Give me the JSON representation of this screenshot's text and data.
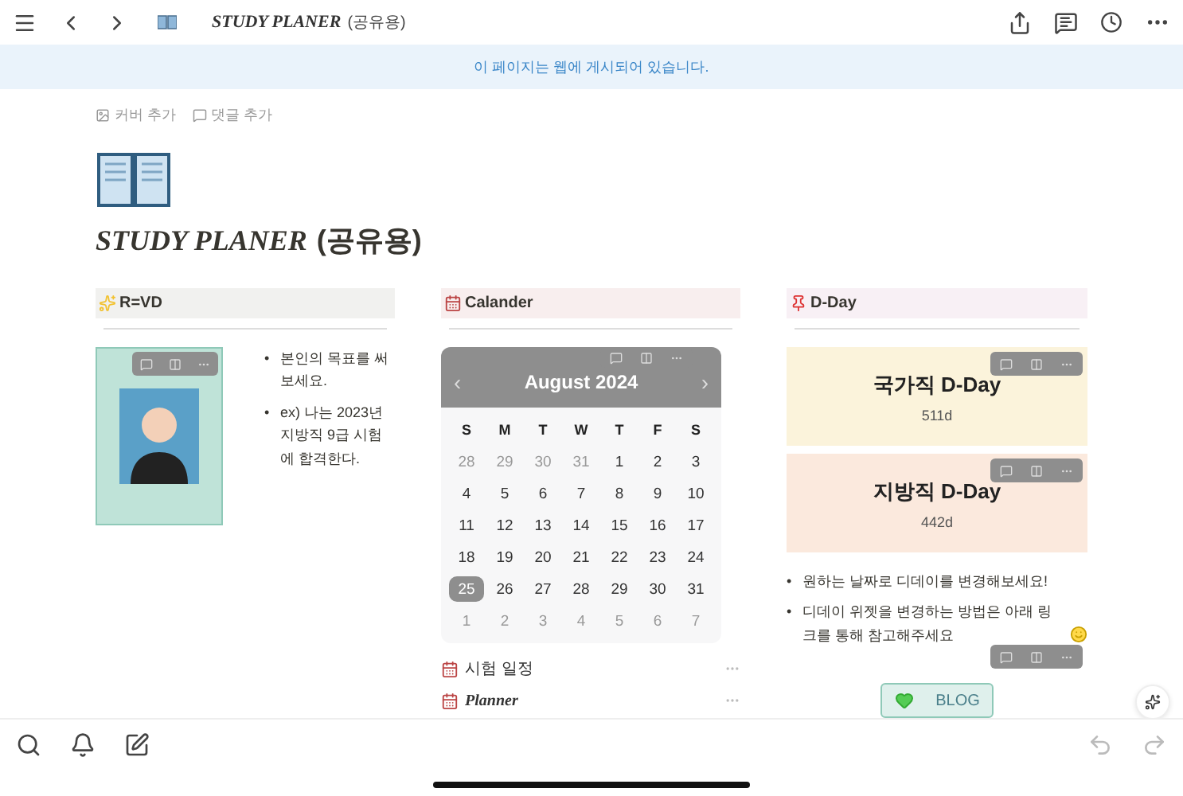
{
  "topbar": {
    "title": "STUDY PLANER",
    "title_suffix": "(공유용)"
  },
  "banner": {
    "text": "이 페이지는 웹에 게시되어 있습니다."
  },
  "page_actions": [
    "커버 추가",
    "댓글 추가"
  ],
  "page_title": {
    "title": "STUDY PLANER",
    "suffix": "(공유용)"
  },
  "columns": [
    {
      "kind": "goal",
      "heading": "R=VD",
      "bullet_mark": "•",
      "bullets": [
        "본인의 목표를 써보세요.",
        "ex) 나는 2023년 지방직 9급 시험에 합격한다."
      ]
    },
    {
      "kind": "calendar",
      "heading": "Calander",
      "calendar": {
        "prev": "‹",
        "next": "›",
        "title": "August 2024",
        "weekdays": [
          "S",
          "M",
          "T",
          "W",
          "T",
          "F",
          "S"
        ],
        "weeks": [
          [
            {
              "day": "28",
              "muted": true,
              "selected": false
            },
            {
              "day": "29",
              "muted": true,
              "selected": false
            },
            {
              "day": "30",
              "muted": true,
              "selected": false
            },
            {
              "day": "31",
              "muted": true,
              "selected": false
            },
            {
              "day": "1",
              "muted": false,
              "selected": false
            },
            {
              "day": "2",
              "muted": false,
              "selected": false
            },
            {
              "day": "3",
              "muted": false,
              "selected": false
            }
          ],
          [
            {
              "day": "4",
              "muted": false,
              "selected": false
            },
            {
              "day": "5",
              "muted": false,
              "selected": false
            },
            {
              "day": "6",
              "muted": false,
              "selected": false
            },
            {
              "day": "7",
              "muted": false,
              "selected": false
            },
            {
              "day": "8",
              "muted": false,
              "selected": false
            },
            {
              "day": "9",
              "muted": false,
              "selected": false
            },
            {
              "day": "10",
              "muted": false,
              "selected": false
            }
          ],
          [
            {
              "day": "11",
              "muted": false,
              "selected": false
            },
            {
              "day": "12",
              "muted": false,
              "selected": false
            },
            {
              "day": "13",
              "muted": false,
              "selected": false
            },
            {
              "day": "14",
              "muted": false,
              "selected": false
            },
            {
              "day": "15",
              "muted": false,
              "selected": false
            },
            {
              "day": "16",
              "muted": false,
              "selected": false
            },
            {
              "day": "17",
              "muted": false,
              "selected": false
            }
          ],
          [
            {
              "day": "18",
              "muted": false,
              "selected": false
            },
            {
              "day": "19",
              "muted": false,
              "selected": false
            },
            {
              "day": "20",
              "muted": false,
              "selected": false
            },
            {
              "day": "21",
              "muted": false,
              "selected": false
            },
            {
              "day": "22",
              "muted": false,
              "selected": false
            },
            {
              "day": "23",
              "muted": false,
              "selected": false
            },
            {
              "day": "24",
              "muted": false,
              "selected": false
            }
          ],
          [
            {
              "day": "25",
              "muted": false,
              "selected": true
            },
            {
              "day": "26",
              "muted": false,
              "selected": false
            },
            {
              "day": "27",
              "muted": false,
              "selected": false
            },
            {
              "day": "28",
              "muted": false,
              "selected": false
            },
            {
              "day": "29",
              "muted": false,
              "selected": false
            },
            {
              "day": "30",
              "muted": false,
              "selected": false
            },
            {
              "day": "31",
              "muted": false,
              "selected": false
            }
          ],
          [
            {
              "day": "1",
              "muted": true,
              "selected": false
            },
            {
              "day": "2",
              "muted": true,
              "selected": false
            },
            {
              "day": "3",
              "muted": true,
              "selected": false
            },
            {
              "day": "4",
              "muted": true,
              "selected": false
            },
            {
              "day": "5",
              "muted": true,
              "selected": false
            },
            {
              "day": "6",
              "muted": true,
              "selected": false
            },
            {
              "day": "7",
              "muted": true,
              "selected": false
            }
          ]
        ]
      },
      "subpages": [
        {
          "title": "시험 일정",
          "kind": "plain"
        },
        {
          "title": "Planner",
          "kind": "serif"
        }
      ]
    },
    {
      "kind": "dday",
      "heading": "D-Day",
      "bullet_mark": "•",
      "cards": [
        {
          "title": "국가직 D-Day",
          "value": "511d",
          "color": "#fbf3db"
        },
        {
          "title": "지방직 D-Day",
          "value": "442d",
          "color": "#fbe9dd"
        }
      ],
      "bullets": [
        "원하는 날짜로 디데이를 변경해보세요!",
        "디데이 위젯을 변경하는 방법은 아래 링크를 통해 참고해주세요"
      ],
      "button": "BLOG"
    }
  ]
}
